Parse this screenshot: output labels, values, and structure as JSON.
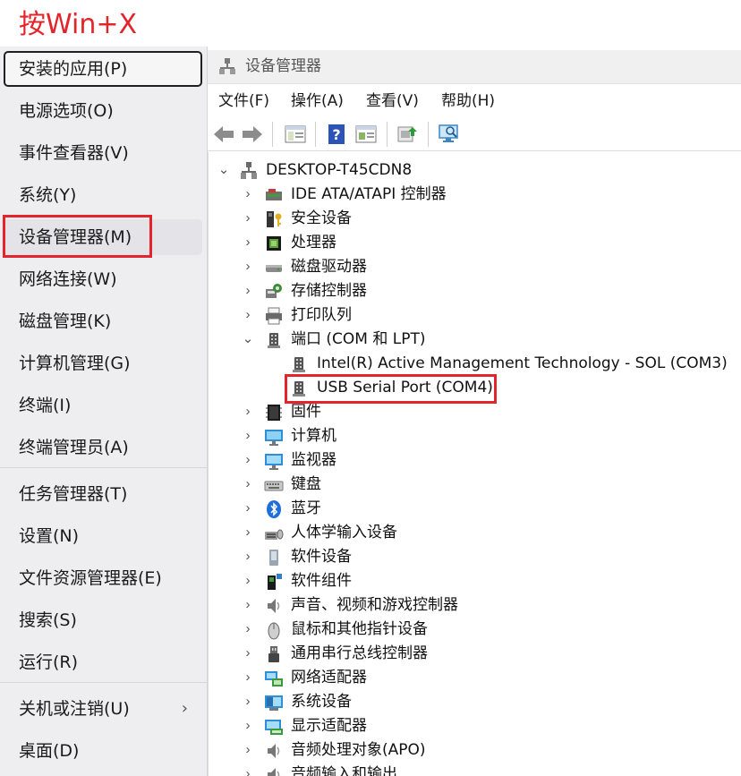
{
  "annotation": {
    "hotkey": "按Win+X"
  },
  "winx_menu": {
    "items": [
      {
        "label": "安装的应用(P)"
      },
      {
        "label": "电源选项(O)"
      },
      {
        "label": "事件查看器(V)"
      },
      {
        "label": "系统(Y)"
      },
      {
        "label": "设备管理器(M)"
      },
      {
        "label": "网络连接(W)"
      },
      {
        "label": "磁盘管理(K)"
      },
      {
        "label": "计算机管理(G)"
      },
      {
        "label": "终端(I)"
      },
      {
        "label": "终端管理员(A)"
      },
      {
        "label": "任务管理器(T)"
      },
      {
        "label": "设置(N)"
      },
      {
        "label": "文件资源管理器(E)"
      },
      {
        "label": "搜索(S)"
      },
      {
        "label": "运行(R)"
      },
      {
        "label": "关机或注销(U)"
      },
      {
        "label": "桌面(D)"
      }
    ]
  },
  "device_manager": {
    "title": "设备管理器",
    "menu": [
      "文件(F)",
      "操作(A)",
      "查看(V)",
      "帮助(H)"
    ],
    "tree": {
      "root": "DESKTOP-T45CDN8",
      "categories": [
        {
          "label": "IDE ATA/ATAPI 控制器",
          "icon": "ide-controller-icon"
        },
        {
          "label": "安全设备",
          "icon": "security-device-icon"
        },
        {
          "label": "处理器",
          "icon": "processor-icon"
        },
        {
          "label": "磁盘驱动器",
          "icon": "disk-drive-icon"
        },
        {
          "label": "存储控制器",
          "icon": "storage-controller-icon"
        },
        {
          "label": "打印队列",
          "icon": "printer-icon"
        },
        {
          "label": "端口 (COM 和 LPT)",
          "icon": "port-icon",
          "expanded": true,
          "children": [
            {
              "label": "Intel(R) Active Management Technology - SOL (COM3)",
              "icon": "port-icon"
            },
            {
              "label": "USB Serial Port (COM4)",
              "icon": "port-icon"
            }
          ]
        },
        {
          "label": "固件",
          "icon": "firmware-icon"
        },
        {
          "label": "计算机",
          "icon": "computer-icon"
        },
        {
          "label": "监视器",
          "icon": "monitor-icon"
        },
        {
          "label": "键盘",
          "icon": "keyboard-icon"
        },
        {
          "label": "蓝牙",
          "icon": "bluetooth-icon"
        },
        {
          "label": "人体学输入设备",
          "icon": "hid-icon"
        },
        {
          "label": "软件设备",
          "icon": "software-device-icon"
        },
        {
          "label": "软件组件",
          "icon": "software-component-icon"
        },
        {
          "label": "声音、视频和游戏控制器",
          "icon": "audio-icon"
        },
        {
          "label": "鼠标和其他指针设备",
          "icon": "mouse-icon"
        },
        {
          "label": "通用串行总线控制器",
          "icon": "usb-icon"
        },
        {
          "label": "网络适配器",
          "icon": "network-adapter-icon"
        },
        {
          "label": "系统设备",
          "icon": "system-device-icon"
        },
        {
          "label": "显示适配器",
          "icon": "display-adapter-icon"
        },
        {
          "label": "音频处理对象(APO)",
          "icon": "audio-icon"
        },
        {
          "label": "音频输入和输出",
          "icon": "audio-icon"
        }
      ]
    }
  },
  "colors": {
    "highlight": "#e3242b",
    "menu_bg": "#eeeef0"
  }
}
